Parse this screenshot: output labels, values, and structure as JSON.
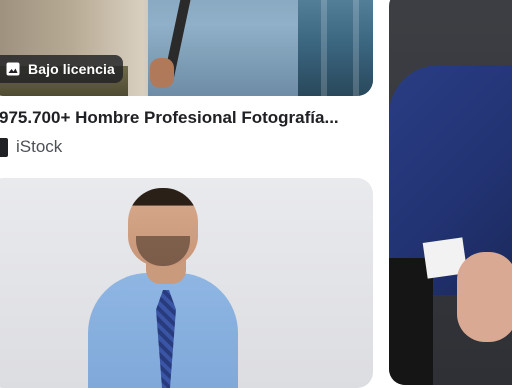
{
  "results": [
    {
      "badge_label": "Bajo licencia",
      "badge_icon": "image-icon",
      "title": "975.700+ Hombre Profesional Fotografía...",
      "source": "iStock"
    }
  ]
}
